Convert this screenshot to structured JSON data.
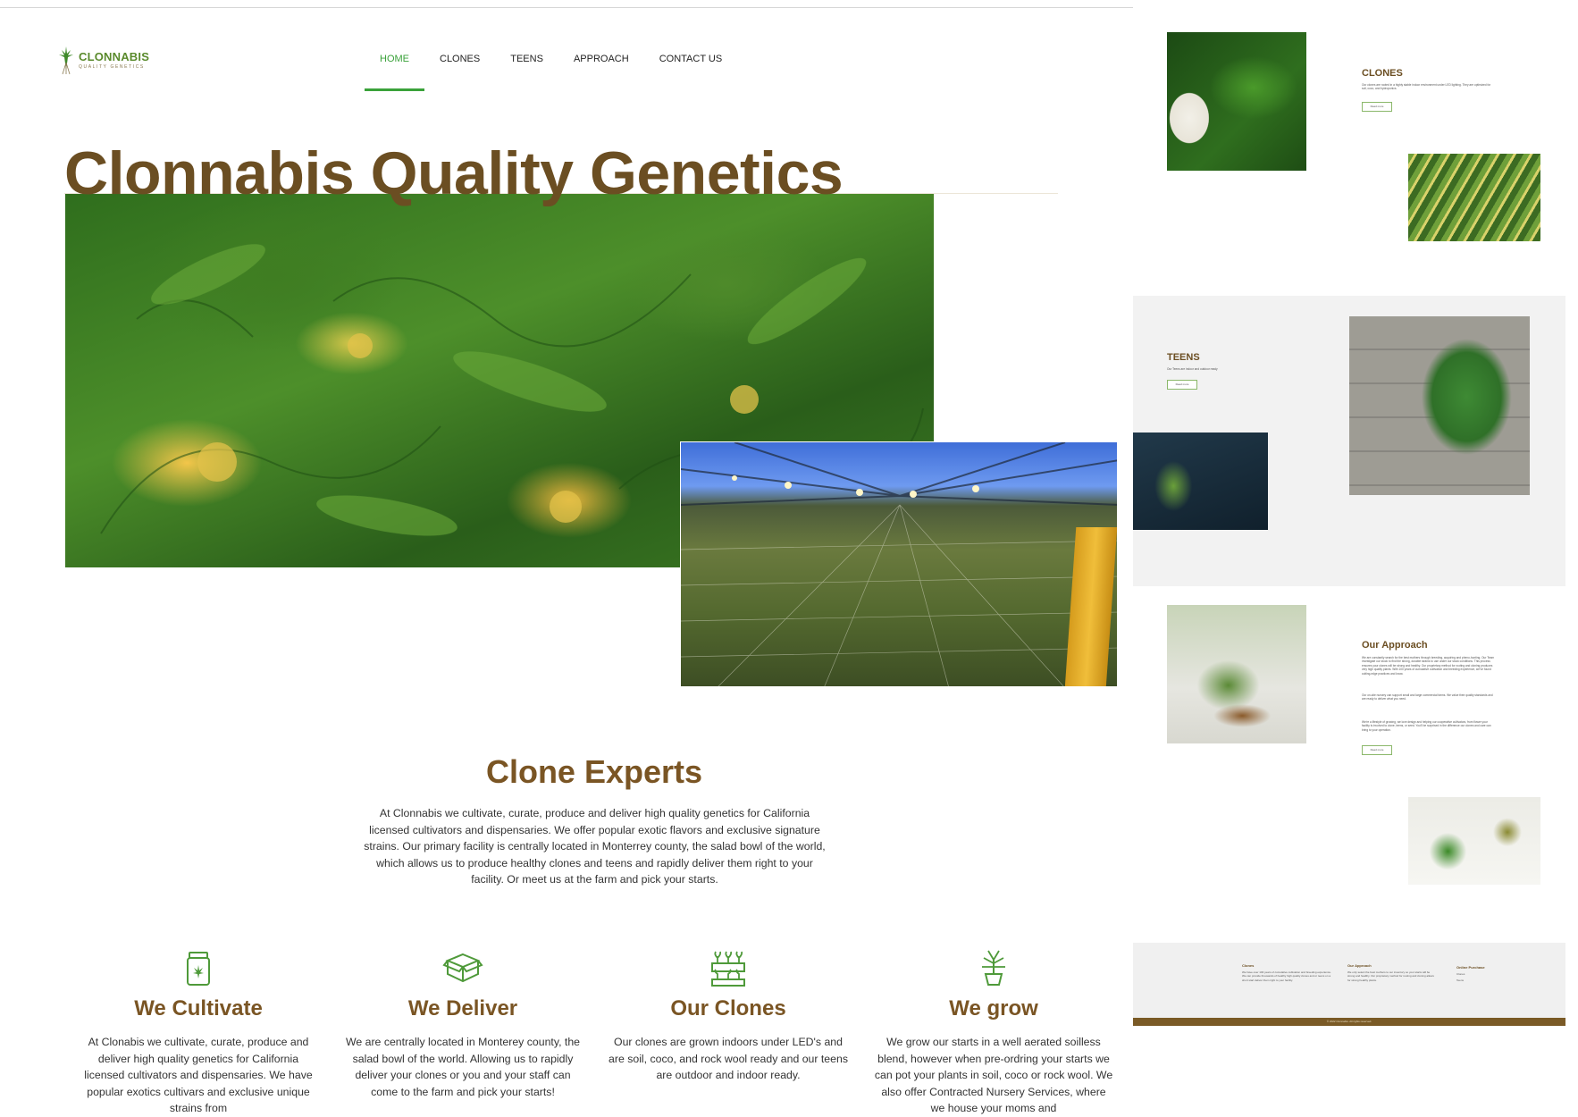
{
  "header": {
    "logo_name": "CLONNABIS",
    "logo_subtitle": "QUALITY GENETICS",
    "nav": [
      "HOME",
      "CLONES",
      "TEENS",
      "APPROACH",
      "CONTACT US"
    ],
    "active_nav": "HOME"
  },
  "hero": {
    "title": "Clonnabis Quality Genetics"
  },
  "clone_experts": {
    "title": "Clone Experts",
    "body": "At Clonnabis we cultivate, curate, produce and deliver high quality genetics for California licensed cultivators and dispensaries. We offer popular exotic flavors and exclusive signature strains. Our primary facility is centrally located in Monterrey county, the salad bowl of the world, which allows us to produce healthy clones and teens and rapidly deliver them right to your facility. Or meet us at the farm and pick your starts."
  },
  "features": [
    {
      "icon": "cannabis-jar-icon",
      "title": "We Cultivate",
      "body": "At Clonabis we cultivate, curate, produce and deliver high quality genetics for California licensed cultivators and dispensaries. We have popular exotics cultivars and exclusive unique strains from"
    },
    {
      "icon": "open-box-icon",
      "title": "We Deliver",
      "body": "We are centrally located in Monterey county, the salad bowl of the world. Allowing us to rapidly deliver your clones or you and your staff can come to the farm and pick your starts!"
    },
    {
      "icon": "growing-trays-icon",
      "title": "Our Clones",
      "body": "Our clones are grown indoors under LED's and are soil, coco, and rock wool ready and our teens are outdoor and indoor ready."
    },
    {
      "icon": "potted-plant-icon",
      "title": "We grow",
      "body": "We grow our starts in a well aerated soilless blend, however when pre-ordring your starts we can pot your plants in soil, coco or rock wool. We also offer Contracted Nursery Services, where we house your moms and"
    }
  ],
  "preview": {
    "clones": {
      "title": "CLONES",
      "text": "Our clones are rooted in a highly stable indoor environment under LED lighting. They are optimized for soil, coco, and hydroponics.",
      "button": "Read more"
    },
    "teens": {
      "title": "TEENS",
      "text": "Our Teens are indoor and outdoor ready",
      "button": "Read more"
    },
    "approach": {
      "title": "Our Approach",
      "text1": "We are constantly search for the best mothers through breeding, acquiring and pheno-hunting. Our Team investigate our stock to find the strong, durable strains to use under our stock conditions. This process ensures your clones will be strong and healthy. Our proprietary method for rooting and cloning produces very high quality plants. With 100 years of cumulative cultivation and breeding experience, we've found cutting-edge practices and know.",
      "text2": "Our on-site nursery can support small and large commercial farms. We value their quality standards and are ready to deliver what you need.",
      "text3": "We're a lifestyle of growing, we love design and helping our cooperative cultivators, from flower your facility is involved to clone, teens, or seed. You'll be surprised in the difference our clones and care can bring to your operation.",
      "button": "Read more"
    },
    "footer": {
      "col1_title": "Clones",
      "col1_text": "We have over 100 years of cumulative cultivation and breeding experience. We can provide thousands of healthy high quality clones and or teens on a short start deliver them right to your facility.",
      "col2_title": "Our Approach",
      "col2_text": "We only select the best mothers to our inventory so your starts will be strong and healthy. Our proprietary method for rooting and cloning allows for strong healthy plants.",
      "col3_title": "Online Purchase",
      "col3_links": [
        "Clones",
        "Teens"
      ],
      "copyright": "© 2022 Clonnabis. All rights reserved."
    }
  }
}
